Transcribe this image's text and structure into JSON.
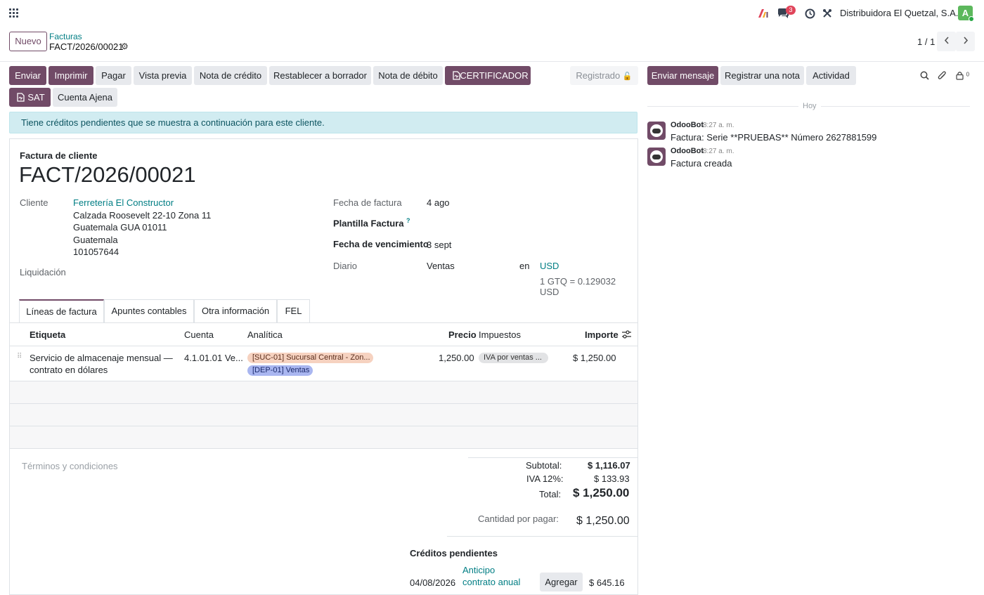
{
  "topbar": {
    "notification_count": "3",
    "company": "Distribuidora El Quetzal, S.A.",
    "avatar_letter": "A"
  },
  "control": {
    "new_label": "Nuevo",
    "breadcrumb_parent": "Facturas",
    "breadcrumb_current": "FACT/2026/00021",
    "pager": "1 / 1"
  },
  "actions": {
    "enviar": "Enviar",
    "imprimir": "Imprimir",
    "pagar": "Pagar",
    "vista_previa": "Vista previa",
    "nota_credito": "Nota de crédito",
    "restablecer": "Restablecer a borrador",
    "nota_debito": "Nota de débito",
    "certificador": "CERTIFICADOR",
    "sat": "SAT",
    "cuenta_ajena": "Cuenta Ajena",
    "status": "Registrado"
  },
  "alert": {
    "pre": "Tiene",
    "strong": "créditos pendientes",
    "post": "que se muestra a continuación para este cliente."
  },
  "invoice": {
    "type_label": "Factura de cliente",
    "number": "FACT/2026/00021",
    "cliente_label": "Cliente",
    "cliente_name": "Ferretería El Constructor",
    "address1": "Calzada Roosevelt 22-10 Zona 11",
    "address2": "Guatemala GUA 01011",
    "address3": "Guatemala",
    "address4": "101057644",
    "liquidacion_label": "Liquidación",
    "fecha_factura_label": "Fecha de factura",
    "fecha_factura": "4 ago",
    "plantilla_label": "Plantilla Factura",
    "plantilla_help": "?",
    "vencimiento_label": "Fecha de vencimiento",
    "vencimiento": "3 sept",
    "diario_label": "Diario",
    "diario": "Ventas",
    "en_label": "en",
    "currency": "USD",
    "rate": "1 GTQ = 0.129032 USD"
  },
  "tabs": [
    "Líneas de factura",
    "Apuntes contables",
    "Otra información",
    "FEL"
  ],
  "table": {
    "headers": {
      "etiqueta": "Etiqueta",
      "cuenta": "Cuenta",
      "analitica": "Analítica",
      "precio": "Precio",
      "impuestos": "Impuestos",
      "importe": "Importe"
    },
    "line": {
      "etiqueta1": "Servicio de almacenaje mensual —",
      "etiqueta2": "contrato en dólares",
      "cuenta": "4.1.01.01 Ve...",
      "tag1": "[SUC-01] Sucursal Central - Zon...",
      "tag2": "[DEP-01] Ventas",
      "precio": "1,250.00",
      "impuesto": "IVA por ventas ...",
      "importe": "$ 1,250.00"
    }
  },
  "terms_placeholder": "Términos y condiciones",
  "totals": {
    "subtotal_label": "Subtotal:",
    "subtotal": "$ 1,116.07",
    "iva_label": "IVA 12%:",
    "iva": "$ 133.93",
    "total_label": "Total:",
    "total": "$ 1,250.00",
    "por_pagar_label": "Cantidad por pagar:",
    "por_pagar": "$ 1,250.00"
  },
  "creditos": {
    "title": "Créditos pendientes",
    "date": "04/08/2026",
    "ref1": "Anticipo",
    "ref2": "contrato anual",
    "button": "Agregar",
    "amount": "$ 645.16"
  },
  "chatter": {
    "send_message": "Enviar mensaje",
    "log_note": "Registrar una nota",
    "activity": "Actividad",
    "follower_count": "0",
    "day_separator": "Hoy",
    "messages": [
      {
        "author": "OdooBot",
        "time": "8:27 a. m.",
        "body": "Factura: Serie **PRUEBAS** Número 2627881599"
      },
      {
        "author": "OdooBot",
        "time": "8:27 a. m.",
        "body": "Factura creada"
      }
    ]
  },
  "colors": {
    "primary": "#714B67",
    "link": "#017e84",
    "alert_bg": "#d1ecf1"
  }
}
